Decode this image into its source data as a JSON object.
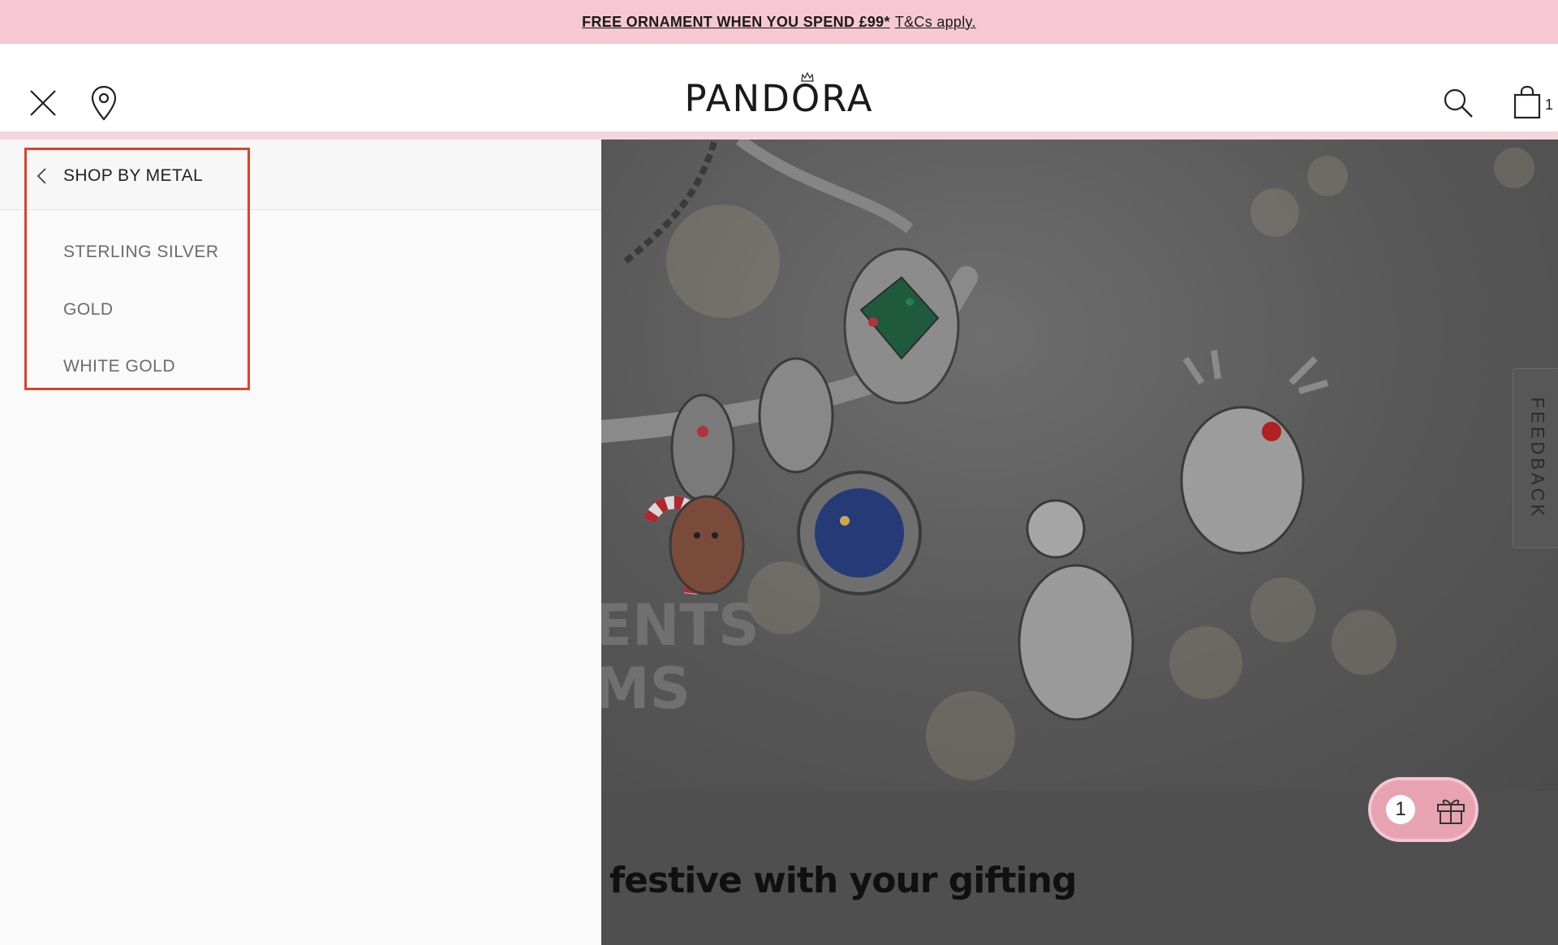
{
  "promo": {
    "bold_text": "FREE ORNAMENT WHEN YOU SPEND £99*",
    "link_text": "T&Cs apply."
  },
  "header": {
    "logo_text": "PANDORA",
    "cart_count": "1"
  },
  "drawer": {
    "back_label": "SHOP BY METAL",
    "items": [
      {
        "label": "STERLING SILVER"
      },
      {
        "label": "GOLD"
      },
      {
        "label": "WHITE GOLD"
      }
    ]
  },
  "hero": {
    "headline_line1": "ENTS",
    "headline_line2": "MS",
    "band_text": "festive with your gifting"
  },
  "feedback": {
    "label": "FEEDBACK"
  },
  "gift": {
    "count": "1"
  },
  "colors": {
    "promo_bg": "#f6c8d3",
    "highlight": "#e0402a",
    "gift_btn": "#e8a3b3"
  }
}
